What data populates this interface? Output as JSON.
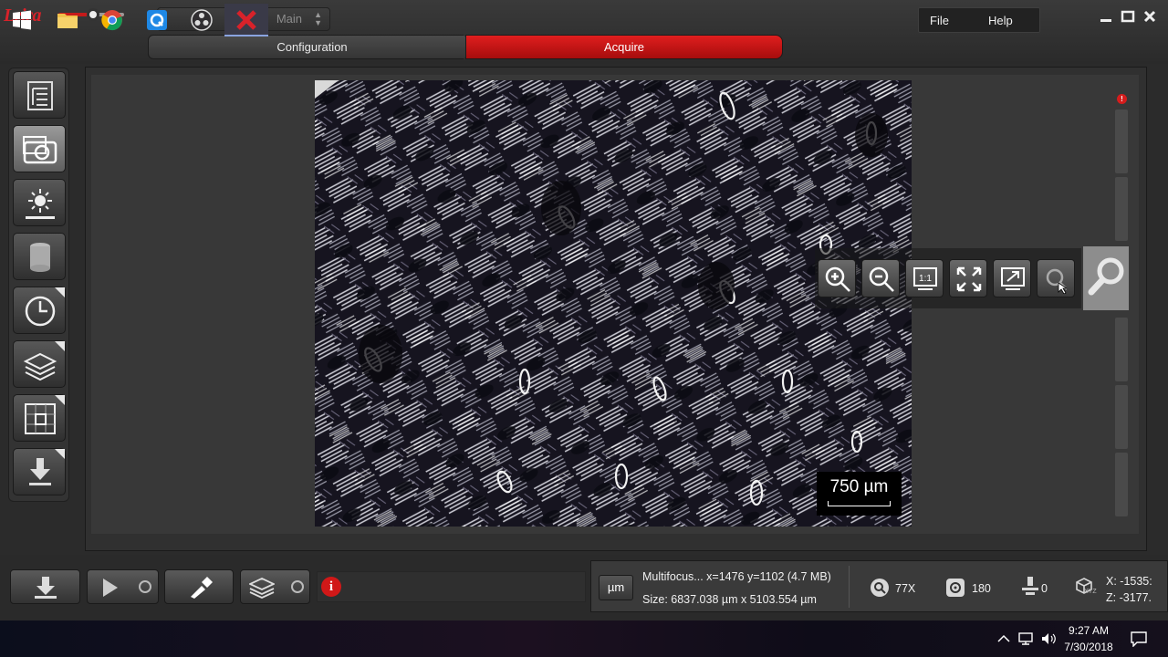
{
  "app": {
    "logo_text": "Leica",
    "workspace": "Main",
    "menu": {
      "file": "File",
      "help": "Help"
    },
    "workflow_tabs": [
      {
        "label": "Configuration",
        "active": false
      },
      {
        "label": "Acquire",
        "active": true
      }
    ],
    "accent_color": "#d01818"
  },
  "left_tools": [
    {
      "name": "project-tree-icon"
    },
    {
      "name": "camera-icon",
      "active": true
    },
    {
      "name": "illumination-icon"
    },
    {
      "name": "storage-icon"
    },
    {
      "name": "timelapse-clock-icon",
      "has_corner": true
    },
    {
      "name": "layers-icon",
      "has_corner": true
    },
    {
      "name": "tile-scan-icon",
      "has_corner": true
    },
    {
      "name": "download-icon",
      "has_corner": true
    }
  ],
  "viewer": {
    "scale_bar_label": "750 µm",
    "zoom_tools": [
      "zoom-in-icon",
      "zoom-out-icon",
      "one-to-one-icon",
      "fit-to-window-icon",
      "fullscreen-icon",
      "reset-zoom-icon"
    ],
    "one_to_one_label": "1:1",
    "alert_badge": "!"
  },
  "status": {
    "unit_button": "µm",
    "line1": "Multifocus... x=1476 y=1102  (4.7 MB)",
    "line2": "Size: 6837.038 µm x 5103.554 µm",
    "zoom": "77X",
    "exposure": "180",
    "focus": "0",
    "coord_x": "X: -1535:",
    "coord_z": "Z: -3177.",
    "xyz_label": "XYZ"
  },
  "taskbar": {
    "time": "9:27 AM",
    "date": "7/30/2018"
  }
}
